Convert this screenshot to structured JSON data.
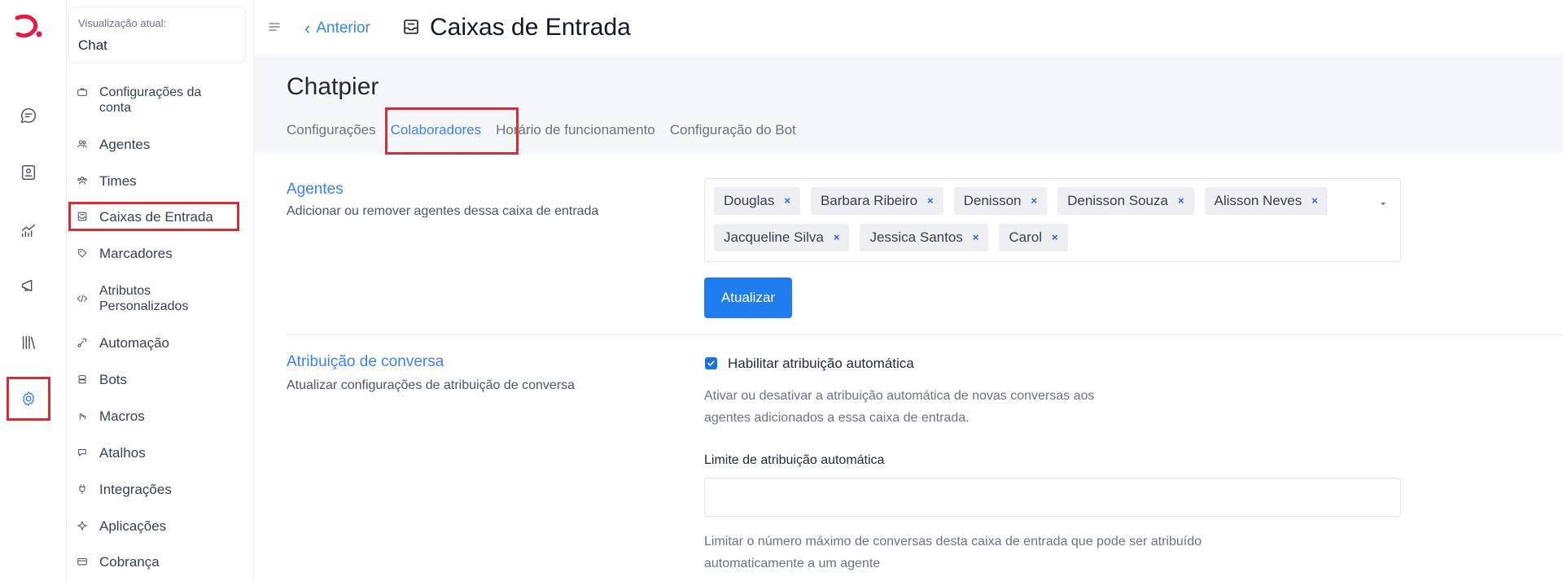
{
  "colors": {
    "accent": "#3b82f6",
    "primary_button": "#1f7df0",
    "highlight_box": "#d32f3a",
    "logo": "#e11d48"
  },
  "rail": {
    "icons": [
      "logo-icon",
      "chat-icon",
      "contacts-icon",
      "reports-icon",
      "campaigns-icon",
      "library-icon",
      "settings-icon"
    ]
  },
  "sidebar": {
    "view_label": "Visualização atual:",
    "view_value": "Chat",
    "items": [
      {
        "label": "Configurações da conta",
        "icon": "briefcase-icon"
      },
      {
        "label": "Agentes",
        "icon": "people-icon"
      },
      {
        "label": "Times",
        "icon": "team-icon"
      },
      {
        "label": "Caixas de Entrada",
        "icon": "inbox-icon"
      },
      {
        "label": "Marcadores",
        "icon": "tag-icon"
      },
      {
        "label": "Atributos Personalizados",
        "icon": "code-icon"
      },
      {
        "label": "Automação",
        "icon": "automation-icon"
      },
      {
        "label": "Bots",
        "icon": "bot-icon"
      },
      {
        "label": "Macros",
        "icon": "macro-icon"
      },
      {
        "label": "Atalhos",
        "icon": "shortcut-icon"
      },
      {
        "label": "Integrações",
        "icon": "plug-icon"
      },
      {
        "label": "Aplicações",
        "icon": "apps-icon"
      },
      {
        "label": "Cobrança",
        "icon": "billing-icon"
      }
    ]
  },
  "header": {
    "back_label": "Anterior",
    "title": "Caixas de Entrada"
  },
  "main": {
    "inbox_name": "Chatpier",
    "tabs": [
      {
        "label": "Configurações",
        "active": false
      },
      {
        "label": "Colaboradores",
        "active": true
      },
      {
        "label": "Horário de funcionamento",
        "active": false
      },
      {
        "label": "Configuração do Bot",
        "active": false
      }
    ],
    "agents_section": {
      "title": "Agentes",
      "description": "Adicionar ou remover agentes dessa caixa de entrada",
      "selected_agents_row1": [
        "Douglas",
        "Barbara Ribeiro",
        "Denisson",
        "Denisson Souza",
        "Alisson Neves"
      ],
      "selected_agents_row2": [
        "Jacqueline Silva",
        "Jessica Santos",
        "Carol"
      ],
      "remove_glyph": "×",
      "update_button": "Atualizar"
    },
    "assignment_section": {
      "title": "Atribuição de conversa",
      "description": "Atualizar configurações de atribuição de conversa",
      "auto_assign_label": "Habilitar atribuição automática",
      "auto_assign_checked": true,
      "auto_assign_help_line1": "Ativar ou desativar a atribuição automática de novas conversas aos",
      "auto_assign_help_line2": "agentes adicionados a essa caixa de entrada.",
      "limit_label": "Limite de atribuição automática",
      "limit_value": "",
      "limit_help_line1": "Limitar o número máximo de conversas desta caixa de entrada que pode ser atribuído",
      "limit_help_line2": "automaticamente a um agente"
    }
  }
}
